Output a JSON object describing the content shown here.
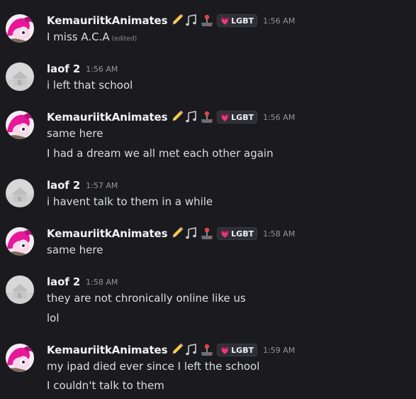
{
  "colors": {
    "background": "#1b1b1f",
    "username": "#f2f3f5",
    "text": "#dbdee1",
    "timestamp": "#94959c",
    "role_heart": "#e88cf7"
  },
  "role": {
    "label": "LGBT",
    "icon": "pink-heart-icon"
  },
  "user_badges": [
    "pencil-emoji",
    "music-notes-emoji",
    "joystick-emoji"
  ],
  "messages": [
    {
      "author": "KemauriitkAnimates",
      "avatar": "pink-pony-avatar",
      "time": "1:56 AM",
      "lines": [
        "I miss A.C.A"
      ],
      "edited_label": "(edited)"
    },
    {
      "author": "laof 2",
      "avatar": "gray-house-avatar",
      "time": "1:56 AM",
      "lines": [
        "i left that school"
      ]
    },
    {
      "author": "KemauriitkAnimates",
      "avatar": "pink-pony-avatar",
      "time": "1:56 AM",
      "lines": [
        "same here",
        "I had a dream we all met each other again"
      ]
    },
    {
      "author": "laof 2",
      "avatar": "gray-house-avatar",
      "time": "1:57 AM",
      "lines": [
        "i havent talk to them in a while"
      ]
    },
    {
      "author": "KemauriitkAnimates",
      "avatar": "pink-pony-avatar",
      "time": "1:58 AM",
      "lines": [
        "same here"
      ]
    },
    {
      "author": "laof 2",
      "avatar": "gray-house-avatar",
      "time": "1:58 AM",
      "lines": [
        "they are not chronically online like us",
        "lol"
      ]
    },
    {
      "author": "KemauriitkAnimates",
      "avatar": "pink-pony-avatar",
      "time": "1:59 AM",
      "lines": [
        "my ipad died ever since I left the school",
        "I couldn't talk to them"
      ]
    }
  ]
}
